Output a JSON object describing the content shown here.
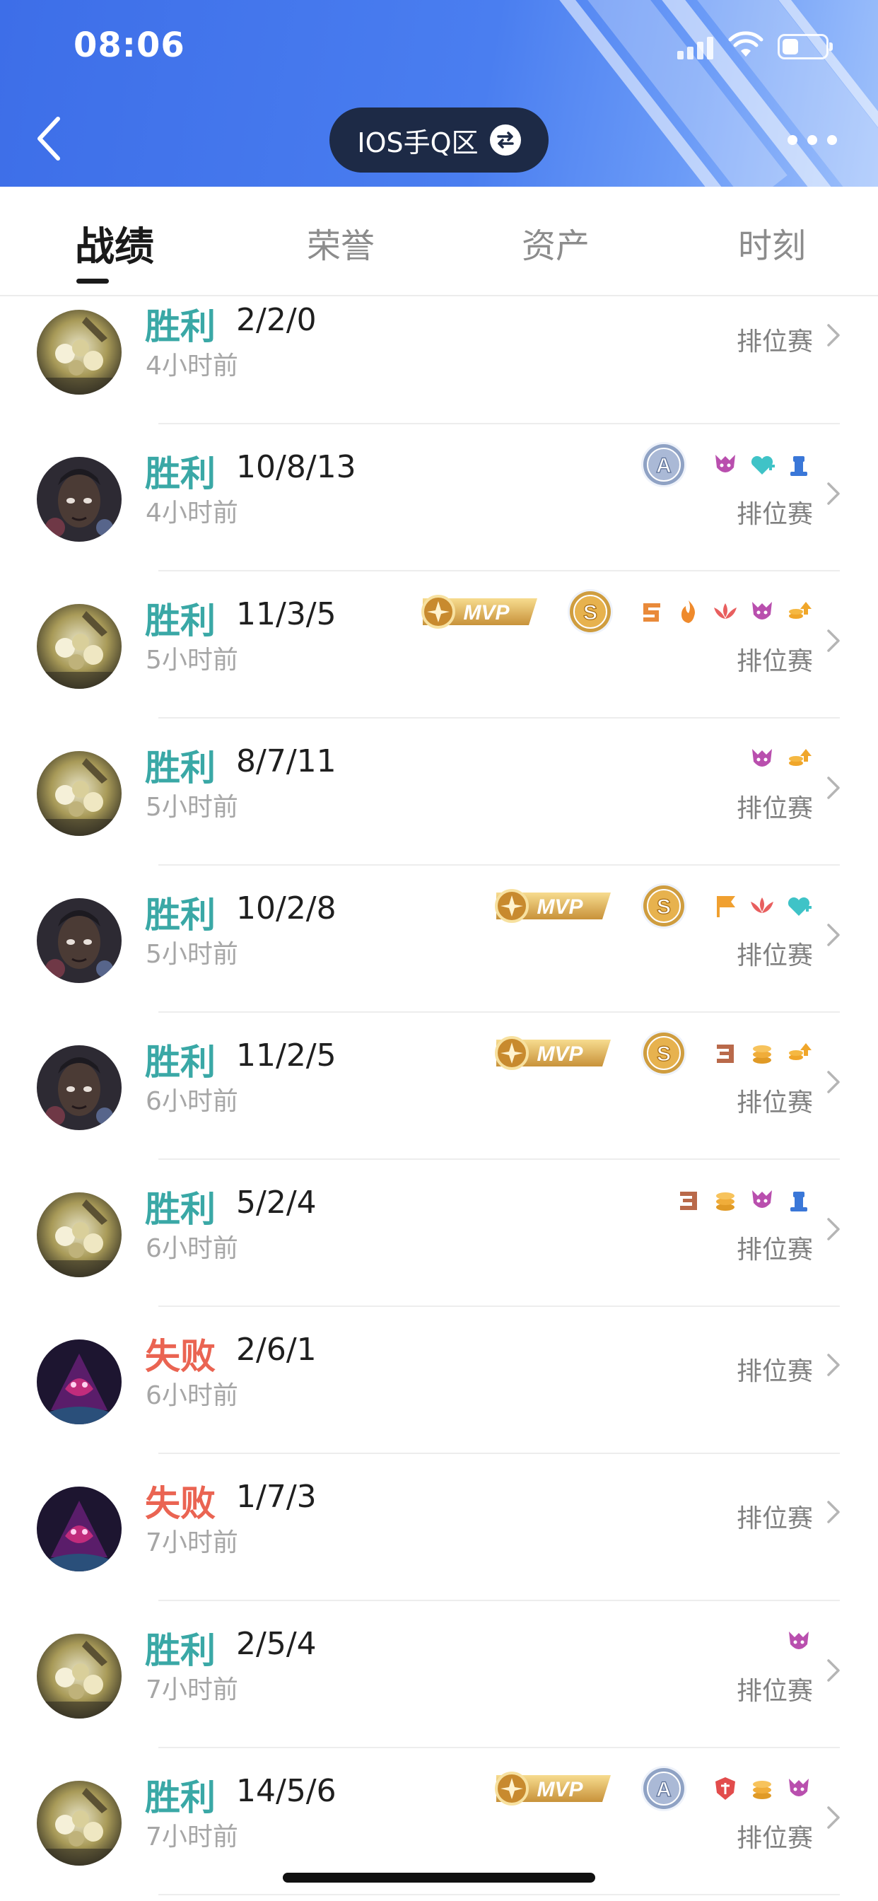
{
  "status_bar": {
    "time": "08:06"
  },
  "nav": {
    "region_label": "IOS手Q区"
  },
  "tabs": [
    {
      "label": "战绩",
      "active": true
    },
    {
      "label": "荣誉",
      "active": false
    },
    {
      "label": "资产",
      "active": false
    },
    {
      "label": "时刻",
      "active": false
    }
  ],
  "matches": [
    {
      "result": "胜利",
      "outcome": "win",
      "kda": "2/2/0",
      "time": "4小时前",
      "mode": "排位赛",
      "hero": "mech",
      "mvp": false,
      "medal": "",
      "icons": []
    },
    {
      "result": "胜利",
      "outcome": "win",
      "kda": "10/8/13",
      "time": "4小时前",
      "mode": "排位赛",
      "hero": "dark",
      "mvp": false,
      "medal": "A",
      "icons": [
        "demon-icon",
        "heal-icon",
        "tower-icon"
      ]
    },
    {
      "result": "胜利",
      "outcome": "win",
      "kda": "11/3/5",
      "time": "5小时前",
      "mode": "排位赛",
      "hero": "mech",
      "mvp": true,
      "medal": "S",
      "icons": [
        "five-kill-icon",
        "fire-icon",
        "lotus-icon",
        "demon-icon",
        "coin-up-icon"
      ]
    },
    {
      "result": "胜利",
      "outcome": "win",
      "kda": "8/7/11",
      "time": "5小时前",
      "mode": "排位赛",
      "hero": "mech",
      "mvp": false,
      "medal": "",
      "icons": [
        "demon-icon",
        "coin-up-icon"
      ]
    },
    {
      "result": "胜利",
      "outcome": "win",
      "kda": "10/2/8",
      "time": "5小时前",
      "mode": "排位赛",
      "hero": "dark",
      "mvp": true,
      "medal": "S",
      "icons": [
        "flag-icon",
        "lotus-icon",
        "heal-icon"
      ]
    },
    {
      "result": "胜利",
      "outcome": "win",
      "kda": "11/2/5",
      "time": "6小时前",
      "mode": "排位赛",
      "hero": "dark",
      "mvp": true,
      "medal": "S",
      "icons": [
        "three-kill-icon",
        "coins-icon",
        "coin-up-icon"
      ]
    },
    {
      "result": "胜利",
      "outcome": "win",
      "kda": "5/2/4",
      "time": "6小时前",
      "mode": "排位赛",
      "hero": "mech",
      "mvp": false,
      "medal": "",
      "icons": [
        "three-kill-icon",
        "coins-icon",
        "demon-icon",
        "tower-icon"
      ]
    },
    {
      "result": "失败",
      "outcome": "lose",
      "kda": "2/6/1",
      "time": "6小时前",
      "mode": "排位赛",
      "hero": "purple",
      "mvp": false,
      "medal": "",
      "icons": []
    },
    {
      "result": "失败",
      "outcome": "lose",
      "kda": "1/7/3",
      "time": "7小时前",
      "mode": "排位赛",
      "hero": "purple",
      "mvp": false,
      "medal": "",
      "icons": []
    },
    {
      "result": "胜利",
      "outcome": "win",
      "kda": "2/5/4",
      "time": "7小时前",
      "mode": "排位赛",
      "hero": "mech",
      "mvp": false,
      "medal": "",
      "icons": [
        "demon-icon"
      ]
    },
    {
      "result": "胜利",
      "outcome": "win",
      "kda": "14/5/6",
      "time": "7小时前",
      "mode": "排位赛",
      "hero": "mech",
      "mvp": true,
      "medal": "A",
      "icons": [
        "crest-icon",
        "coins-icon",
        "demon-icon"
      ]
    }
  ],
  "badge_text": {
    "mvp": "MVP"
  },
  "colors": {
    "header_blue": "#3d6ee8",
    "win": "#3aa8a6",
    "lose": "#ea6452",
    "pill": "#1d2a46"
  }
}
